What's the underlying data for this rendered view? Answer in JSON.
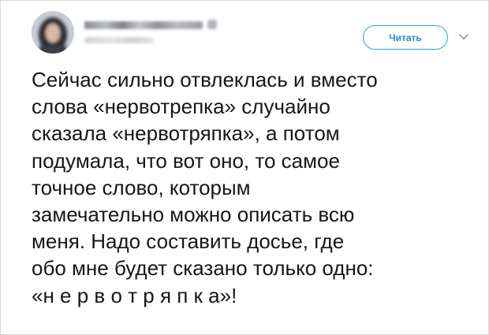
{
  "tweet": {
    "author": {
      "avatar_icon": "user-avatar-blurred",
      "verified_icon": "verified-badge-icon"
    },
    "follow_button_label": "Читать",
    "menu_icon": "chevron-down-icon",
    "text_lines": [
      "Сейчас сильно отвлеклась и вместо",
      "слова «нервотрепка» случайно",
      "сказала «нервотряпка», а потом",
      "подумала, что вот оно, то самое",
      "точное слово, которым",
      "замечательно можно описать всю",
      "меня. Надо составить досье, где",
      "обо мне будет сказано только одно:",
      "«н е р в о т р я п к а»!"
    ]
  },
  "colors": {
    "accent": "#1da1f2",
    "text": "#14171a",
    "border": "#d9d9d9"
  }
}
